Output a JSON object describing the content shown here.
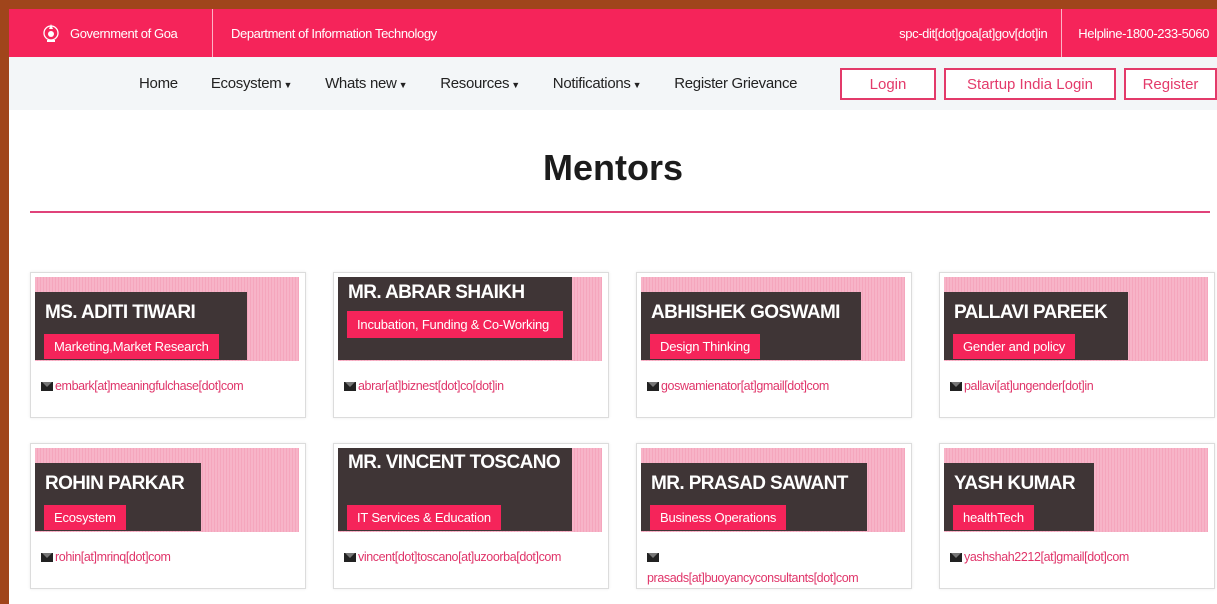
{
  "topbar": {
    "gov": "Government of Goa",
    "dept": "Department of Information Technology",
    "email": "spc-dit[dot]goa[at]gov[dot]in",
    "helpline": "Helpline-1800-233-5060"
  },
  "nav": {
    "items": [
      {
        "label": "Home",
        "dropdown": false
      },
      {
        "label": "Ecosystem",
        "dropdown": true
      },
      {
        "label": "Whats new",
        "dropdown": true
      },
      {
        "label": "Resources",
        "dropdown": true
      },
      {
        "label": "Notifications",
        "dropdown": true
      },
      {
        "label": "Register Grievance",
        "dropdown": false
      }
    ],
    "login": "Login",
    "startup_login": "Startup India Login",
    "register": "Register"
  },
  "page": {
    "title": "Mentors"
  },
  "mentors": [
    {
      "name": "MS. ADITI TIWARI",
      "tag": "Marketing,Market Research",
      "email": "embark[at]meaningfulchase[dot]com"
    },
    {
      "name": "MR. ABRAR SHAIKH",
      "tag": "Incubation, Funding & Co-Working",
      "email": "abrar[at]biznest[dot]co[dot]in"
    },
    {
      "name": "ABHISHEK GOSWAMI",
      "tag": "Design Thinking",
      "email": "goswamienator[at]gmail[dot]com"
    },
    {
      "name": "PALLAVI PAREEK",
      "tag": "Gender and policy",
      "email": "pallavi[at]ungender[dot]in"
    },
    {
      "name": "ROHIN PARKAR",
      "tag": "Ecosystem",
      "email": "rohin[at]mrinq[dot]com"
    },
    {
      "name": "MR. VINCENT TOSCANO",
      "tag": "IT Services & Education",
      "email": "vincent[dot]toscano[at]uzoorba[dot]com"
    },
    {
      "name": "MR. PRASAD SAWANT",
      "tag": "Business Operations",
      "email": "prasads[at]buoyancyconsultants[dot]com"
    },
    {
      "name": "YASH KUMAR",
      "tag": "healthTech",
      "email": "yashshah2212[at]gmail[dot]com"
    }
  ],
  "colors": {
    "brand": "#f5245a",
    "dark": "#3f3536",
    "outer": "#a0451b"
  }
}
